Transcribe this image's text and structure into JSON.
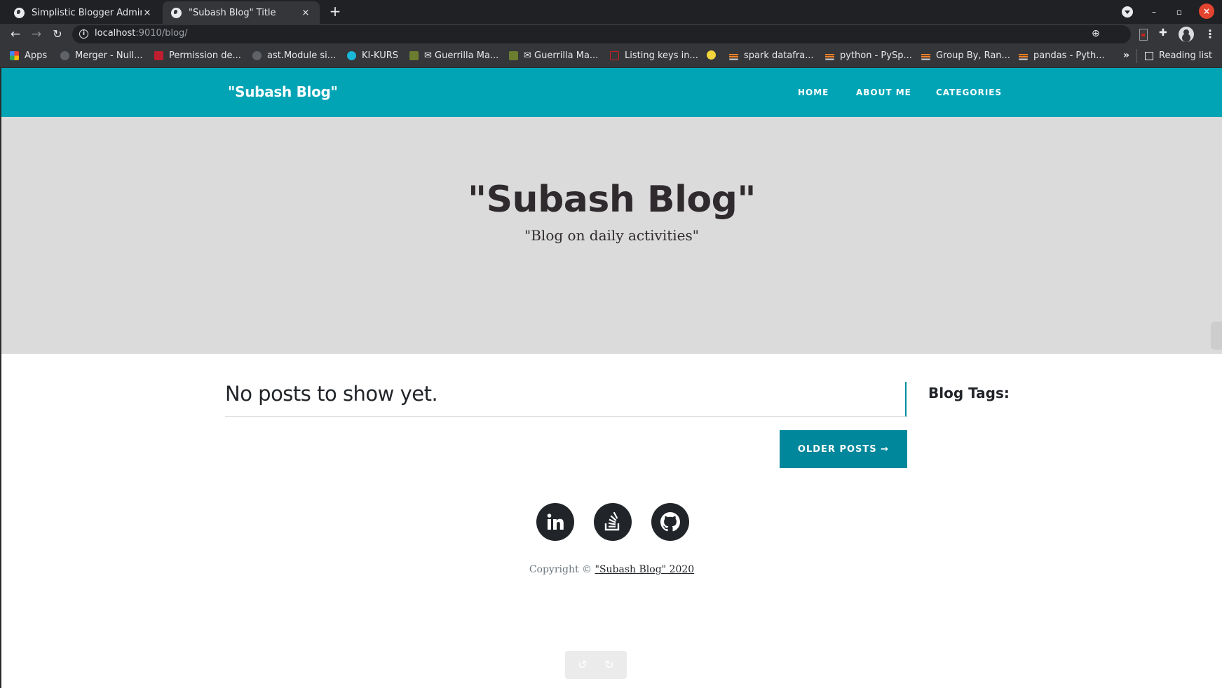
{
  "browser": {
    "tabs": [
      {
        "title": "Simplistic Blogger Admin",
        "active": false,
        "icon": "globe-icon"
      },
      {
        "title": "\"Subash Blog\" Title",
        "active": true,
        "icon": "globe-icon"
      }
    ],
    "close_glyph": "×",
    "new_tab_glyph": "+",
    "url_host": "localhost",
    "url_rest": ":9010/blog/",
    "nav_glyphs": {
      "back": "←",
      "forward": "→",
      "reload": "↻",
      "info": "i"
    },
    "toolbar_glyphs": {
      "zoom": "⊕",
      "star": "☆",
      "puzzle": "✚",
      "kebab": "⋮"
    },
    "window_glyphs": {
      "minimize": "–",
      "maximize": "▫",
      "close": "×"
    },
    "bookmarks": [
      {
        "label": "Apps",
        "icon": "apps"
      },
      {
        "label": "Merger - Null...",
        "icon": "gh"
      },
      {
        "label": "Permission de...",
        "icon": "hib"
      },
      {
        "label": "ast.Module si...",
        "icon": "gh"
      },
      {
        "label": "KI-KURS",
        "icon": "ki"
      },
      {
        "label": "✉ Guerrilla Ma...",
        "icon": "gm"
      },
      {
        "label": "✉ Guerrilla Ma...",
        "icon": "gm"
      },
      {
        "label": "Listing keys in...",
        "icon": "red"
      },
      {
        "label": "",
        "icon": "yellow"
      },
      {
        "label": "spark datafra...",
        "icon": "so"
      },
      {
        "label": "python - PySp...",
        "icon": "so"
      },
      {
        "label": "Group By, Ran...",
        "icon": "so"
      },
      {
        "label": "pandas - Pyth...",
        "icon": "so"
      }
    ],
    "bookmarks_more": "»",
    "reading_list": "Reading list"
  },
  "site": {
    "brand": "\"Subash Blog\"",
    "nav": [
      {
        "label": "HOME"
      },
      {
        "label": "ABOUT ME"
      },
      {
        "label": "CATEGORIES"
      }
    ],
    "hero": {
      "title": "\"Subash Blog\"",
      "subtitle": "\"Blog on daily activities\""
    },
    "empty_message": "No posts to show yet.",
    "sidebar_title": "Blog Tags:",
    "older_posts": "OLDER POSTS →",
    "social": [
      {
        "name": "LinkedIn"
      },
      {
        "name": "Stack Overflow"
      },
      {
        "name": "GitHub"
      }
    ],
    "copyright_prefix": "Copyright © ",
    "copyright_link": "\"Subash Blog\" 2020",
    "accent_color": "#00a4b5",
    "button_color": "#00879b",
    "hero_bg": "#dbdbdb"
  },
  "undo_bar": {
    "undo": "↺",
    "redo": "↻"
  }
}
